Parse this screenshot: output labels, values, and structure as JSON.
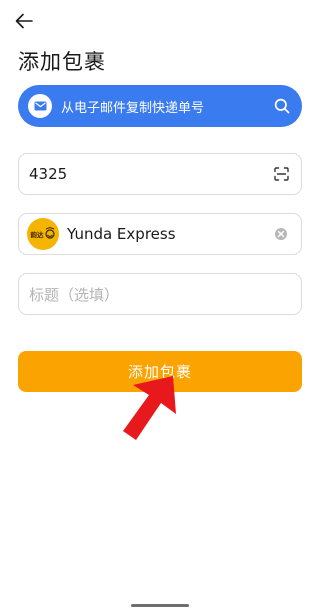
{
  "header": {
    "back_icon": "arrow-left-icon",
    "title": "添加包裹"
  },
  "email_banner": {
    "icon": "mail-icon",
    "text": "从电子邮件复制快递单号",
    "trailing_icon": "search-icon",
    "color": "#3a7bf0"
  },
  "form": {
    "tracking_number": {
      "value": "4325",
      "trailing_icon": "scan-icon"
    },
    "carrier": {
      "logo_icon": "yunda-logo-icon",
      "logo_text": "韵达",
      "value": "Yunda Express",
      "trailing_icon": "clear-icon"
    },
    "title": {
      "placeholder": "标题（选填）",
      "value": ""
    }
  },
  "submit": {
    "label": "添加包裹",
    "color": "#fba300"
  },
  "annotation": {
    "icon": "red-arrow-icon",
    "color": "#e8191c"
  }
}
